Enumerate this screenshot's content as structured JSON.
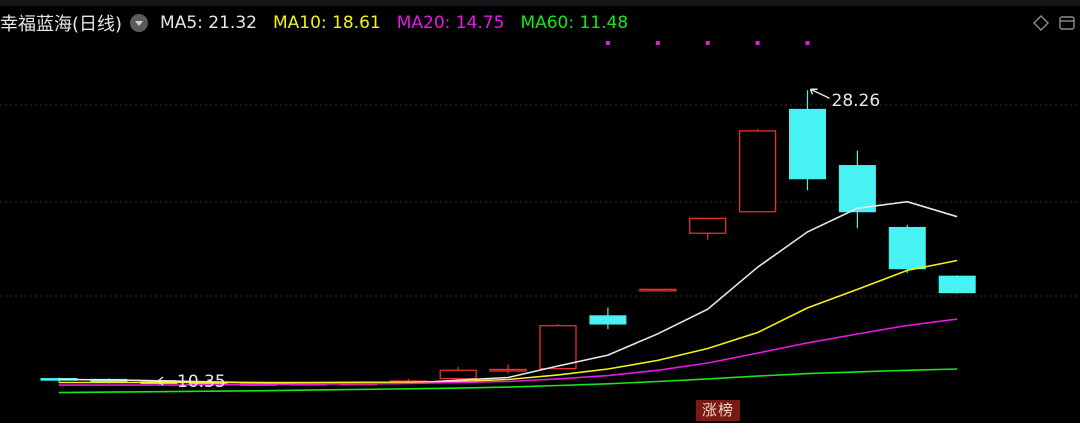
{
  "header": {
    "stock_name": "幸福蓝海(日线)",
    "dropdown_icon": "chevron-down-icon",
    "ma": [
      {
        "label": "MA5: 21.32",
        "color": "#e8e8e8"
      },
      {
        "label": "MA10: 18.61",
        "color": "#f2f21a"
      },
      {
        "label": "MA20: 14.75",
        "color": "#e619e6"
      },
      {
        "label": "MA60: 11.48",
        "color": "#19e619"
      }
    ],
    "right_icons": [
      "diamond-icon",
      "window-icon"
    ]
  },
  "badge": {
    "label": "涨榜"
  },
  "colors": {
    "up": "#e8302c",
    "down": "#46f2f2",
    "grid": "#2a3038",
    "signal_dot": "#e619e6",
    "annotation": "#e8e8e8"
  },
  "chart_data": {
    "type": "candlestick",
    "title": "幸福蓝海(日线)",
    "ylim": [
      9.5,
      31.0
    ],
    "grid": true,
    "candles": [
      {
        "o": 10.8,
        "h": 10.85,
        "l": 10.55,
        "c": 10.7
      },
      {
        "o": 10.75,
        "h": 10.8,
        "l": 10.5,
        "c": 10.6
      },
      {
        "o": 10.6,
        "h": 10.7,
        "l": 10.4,
        "c": 10.5
      },
      {
        "o": 10.5,
        "h": 10.55,
        "l": 10.35,
        "c": 10.45
      },
      {
        "o": 10.45,
        "h": 10.6,
        "l": 10.4,
        "c": 10.48
      },
      {
        "o": 10.48,
        "h": 10.55,
        "l": 10.42,
        "c": 10.5
      },
      {
        "o": 10.5,
        "h": 10.6,
        "l": 10.44,
        "c": 10.52
      },
      {
        "o": 10.52,
        "h": 10.8,
        "l": 10.48,
        "c": 10.65
      },
      {
        "o": 10.8,
        "h": 11.5,
        "l": 10.7,
        "c": 11.3
      },
      {
        "o": 11.3,
        "h": 11.65,
        "l": 11.1,
        "c": 11.35
      },
      {
        "o": 11.4,
        "h": 14.1,
        "l": 11.4,
        "c": 14.0
      },
      {
        "o": 14.6,
        "h": 15.1,
        "l": 13.8,
        "c": 14.1
      },
      {
        "o": 16.2,
        "h": 16.2,
        "l": 16.2,
        "c": 16.2
      },
      {
        "o": 19.6,
        "h": 20.5,
        "l": 19.2,
        "c": 20.5
      },
      {
        "o": 20.9,
        "h": 25.9,
        "l": 20.9,
        "c": 25.8
      },
      {
        "o": 27.1,
        "h": 28.26,
        "l": 22.2,
        "c": 22.9
      },
      {
        "o": 23.7,
        "h": 24.6,
        "l": 19.9,
        "c": 20.9
      },
      {
        "o": 19.95,
        "h": 20.1,
        "l": 17.2,
        "c": 17.45
      },
      {
        "o": 17.0,
        "h": 17.05,
        "l": 15.95,
        "c": 16.0
      }
    ],
    "ma_series": [
      {
        "name": "MA5",
        "color": "#e8e8e8",
        "values": [
          10.75,
          10.72,
          10.66,
          10.6,
          10.55,
          10.51,
          10.49,
          10.52,
          10.7,
          10.86,
          11.56,
          12.22,
          13.51,
          15.0,
          17.54,
          19.68,
          21.11,
          21.51,
          20.6
        ]
      },
      {
        "name": "MA10",
        "color": "#f2f21a",
        "values": [
          10.56,
          10.56,
          10.56,
          10.56,
          10.56,
          10.56,
          10.57,
          10.58,
          10.62,
          10.74,
          11.02,
          11.38,
          11.9,
          12.62,
          13.59,
          15.08,
          16.2,
          17.35,
          17.95
        ]
      },
      {
        "name": "MA20",
        "color": "#e619e6",
        "values": [
          10.4,
          10.4,
          10.4,
          10.42,
          10.44,
          10.46,
          10.48,
          10.5,
          10.56,
          10.62,
          10.78,
          10.98,
          11.3,
          11.74,
          12.34,
          12.96,
          13.5,
          14.01,
          14.4
        ]
      },
      {
        "name": "MA60",
        "color": "#19e619",
        "values": [
          9.95,
          9.98,
          10.0,
          10.03,
          10.06,
          10.1,
          10.14,
          10.18,
          10.22,
          10.28,
          10.38,
          10.48,
          10.62,
          10.78,
          10.95,
          11.1,
          11.2,
          11.3,
          11.38
        ]
      }
    ],
    "signal_dots": [
      11,
      12,
      13,
      14,
      15
    ],
    "annotations": [
      {
        "label": "28.26",
        "index": 15,
        "value": 28.26,
        "side": "right"
      },
      {
        "label": "10.35",
        "index": 3,
        "value": 10.35,
        "side": "right"
      }
    ]
  }
}
